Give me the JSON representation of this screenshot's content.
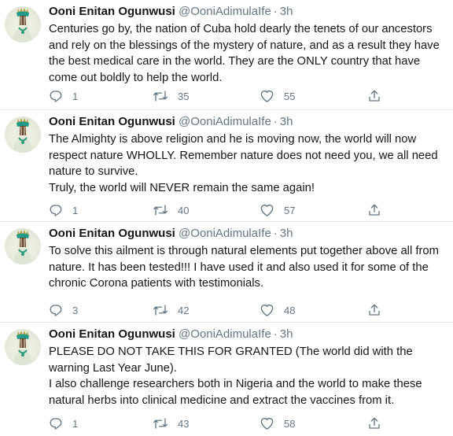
{
  "tweets": [
    {
      "name": "Ooni Enitan Ogunwusi",
      "handle": "@OoniAdimulaIfe",
      "separator": "·",
      "time": "3h",
      "lines": [
        "Centuries go by, the nation of Cuba hold dearly the tenets of our ancestors and rely on the blessings of the mystery of nature, and as a result they have the best medical care in the world. They are the ONLY country that have come out boldly to help the world."
      ],
      "replies": "1",
      "retweets": "35",
      "likes": "55"
    },
    {
      "name": "Ooni Enitan Ogunwusi",
      "handle": "@OoniAdimulaIfe",
      "separator": "·",
      "time": "3h",
      "lines": [
        "The Almighty is above religion and he is moving now, the world will now respect nature WHOLLY. Remember nature does not need you, we all need nature to survive.",
        "Truly, the world will NEVER remain the same again!"
      ],
      "replies": "1",
      "retweets": "40",
      "likes": "57"
    },
    {
      "name": "Ooni Enitan Ogunwusi",
      "handle": "@OoniAdimulaIfe",
      "separator": "·",
      "time": "3h",
      "lines": [
        "To solve this ailment is through natural elements put together above all from nature. It has been tested!!! I have used it and also used it for some of the chronic Corona patients with testimonials."
      ],
      "replies": "3",
      "retweets": "42",
      "likes": "48"
    },
    {
      "name": "Ooni Enitan Ogunwusi",
      "handle": "@OoniAdimulaIfe",
      "separator": "·",
      "time": "3h",
      "lines": [
        "PLEASE DO NOT TAKE THIS FOR GRANTED (The world did with the warning Last Year June).",
        "I also challenge researchers both in Nigeria and the world to make these natural herbs into clinical medicine and extract the vaccines from it."
      ],
      "replies": "1",
      "retweets": "43",
      "likes": "58"
    }
  ],
  "icons": {
    "reply": "reply-icon",
    "retweet": "retweet-icon",
    "like": "heart-icon",
    "share": "share-icon",
    "avatar": "profile-avatar"
  },
  "colors": {
    "text": "#14171a",
    "secondary": "#657786",
    "divider": "#e6ecf0"
  }
}
